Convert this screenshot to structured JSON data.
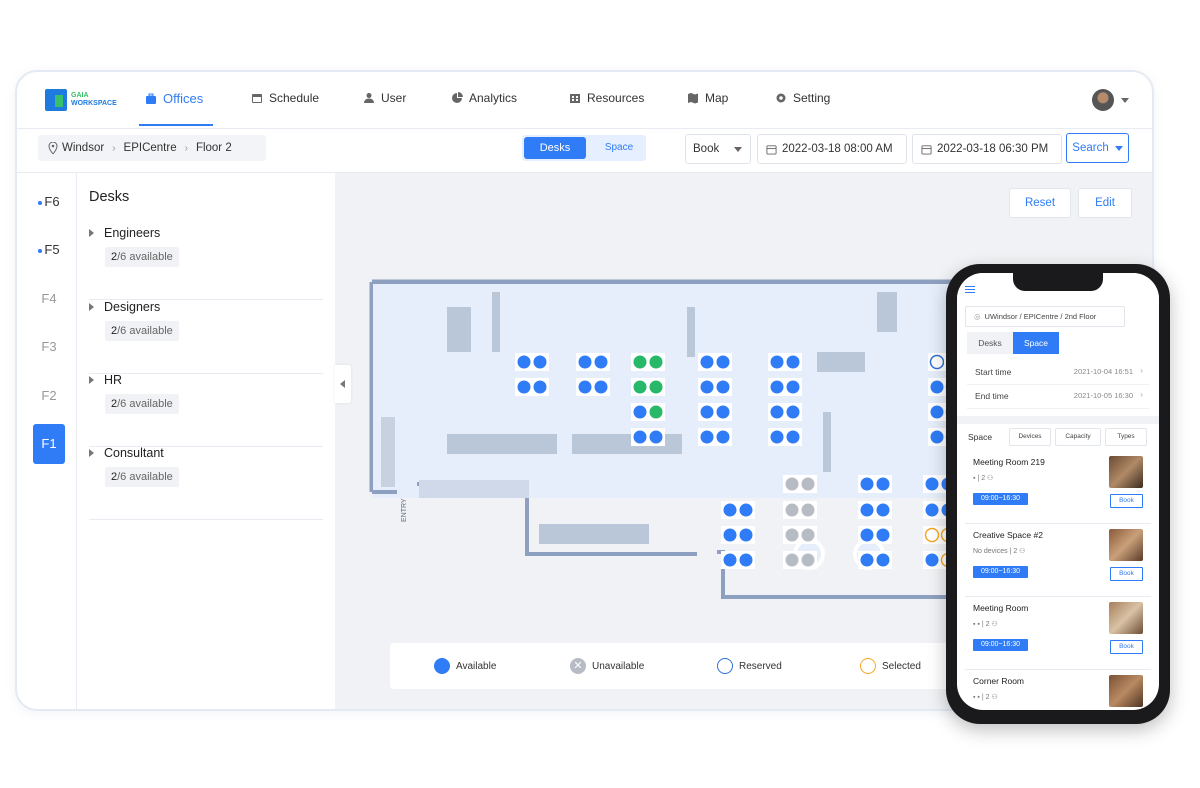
{
  "brand": {
    "line1": "GAIA",
    "line2": "WORKSPACE"
  },
  "nav": {
    "offices": "Offices",
    "schedule": "Schedule",
    "user": "User",
    "analytics": "Analytics",
    "resources": "Resources",
    "map": "Map",
    "setting": "Setting"
  },
  "breadcrumb": {
    "site": "Windsor",
    "building": "EPICentre",
    "floor": "Floor 2"
  },
  "view_toggle": {
    "desks": "Desks",
    "space": "Space"
  },
  "booking": {
    "mode": "Book",
    "start": "2022-03-18 08:00 AM",
    "end": "2022-03-18 06:30 PM",
    "search": "Search"
  },
  "floors": [
    "F6",
    "F5",
    "F4",
    "F3",
    "F2",
    "F1"
  ],
  "desks_panel": {
    "title": "Desks",
    "groups": [
      {
        "name": "Engineers",
        "available": "2",
        "total": "/6 available"
      },
      {
        "name": "Designers",
        "available": "2",
        "total": "/6 available"
      },
      {
        "name": "HR",
        "available": "2",
        "total": "/6 available"
      },
      {
        "name": "Consultant",
        "available": "2",
        "total": "/6 available"
      }
    ]
  },
  "map_actions": {
    "reset": "Reset",
    "edit": "Edit"
  },
  "map_labels": {
    "entry": "ENTRY"
  },
  "legend": {
    "available": "Available",
    "unavailable": "Unavailable",
    "reserved": "Reserved",
    "selected": "Selected"
  },
  "colors": {
    "accent": "#2f7cf6",
    "available": "#2f7cf6",
    "occupied_green": "#27b86a",
    "unavailable": "#b7bcc4",
    "selected": "#f5a623"
  },
  "phone": {
    "breadcrumb": "UWindsor / EPICentre / 2nd Floor",
    "toggle": {
      "desks": "Desks",
      "space": "Space"
    },
    "start_label": "Start time",
    "start_value": "2021-10-04 16:51",
    "end_label": "End time",
    "end_value": "2021-10-05 16:30",
    "section": "Space",
    "filters": [
      "Devices",
      "Capacity",
      "Types"
    ],
    "rooms": [
      {
        "name": "Meeting Room 219",
        "meta": "| 2",
        "time": "09:00~16:30",
        "book": "Book"
      },
      {
        "name": "Creative Space #2",
        "meta": "No devices | 2",
        "time": "09:00~16:30",
        "book": "Book"
      },
      {
        "name": "Meeting Room",
        "meta": "| 2",
        "time": "09:00~16:30",
        "book": "Book"
      },
      {
        "name": "Corner Room",
        "meta": "| 2",
        "time": "",
        "book": ""
      }
    ]
  }
}
